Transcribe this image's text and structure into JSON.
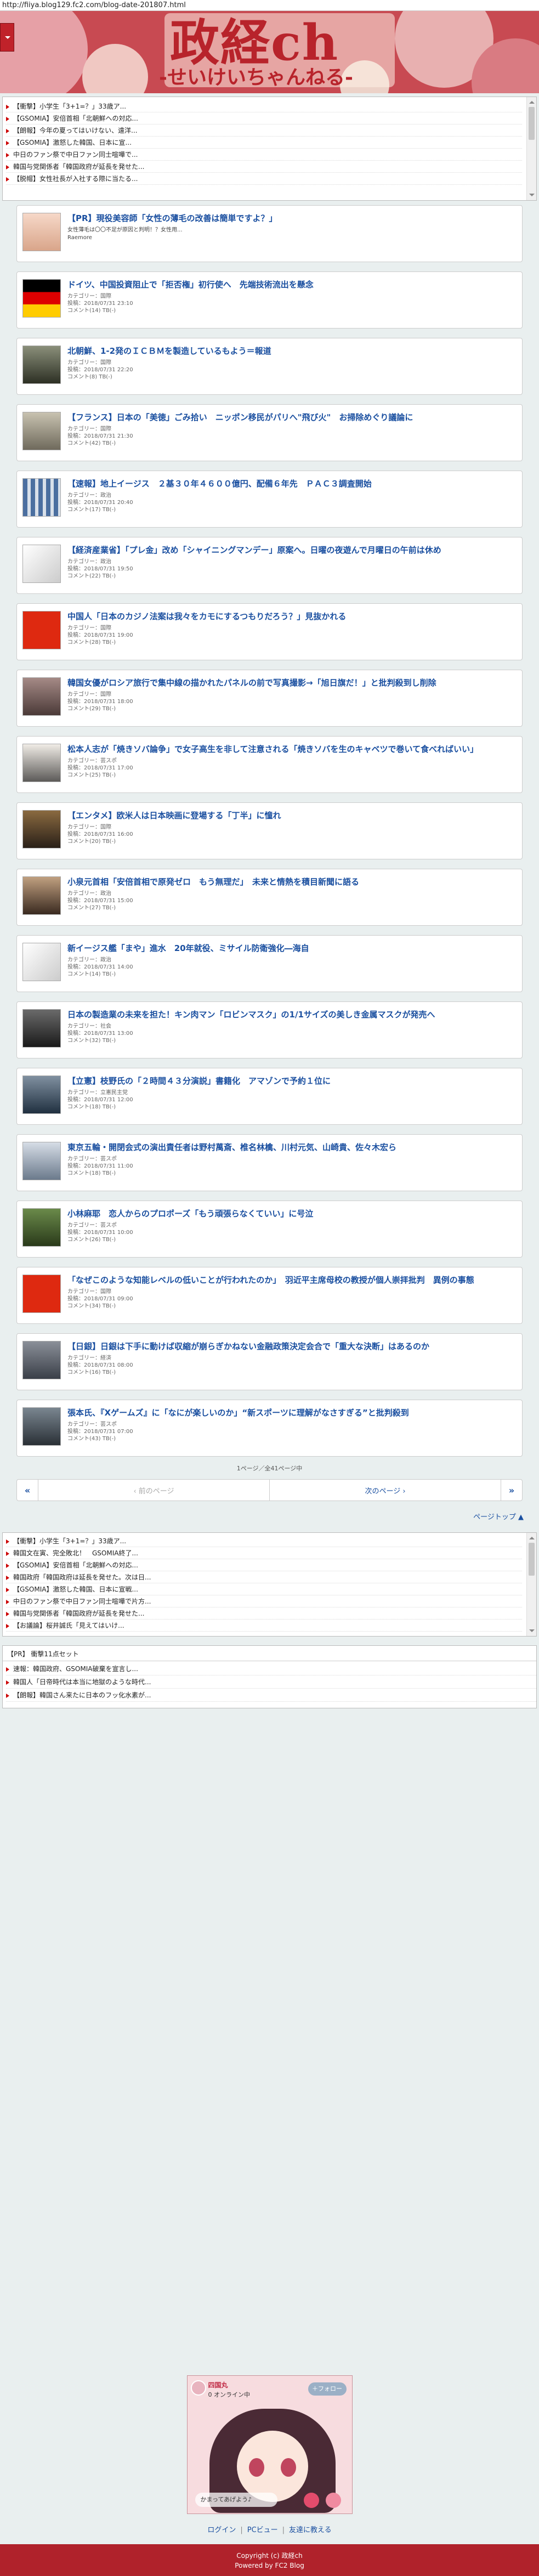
{
  "url": "http://fiiya.blog129.fc2.com/blog-date-201807.html",
  "header": {
    "title": "政経ch",
    "subtitle": "-せいけいちゃんねる-"
  },
  "ticker_top": [
    "【衝撃】小学生「3+1=？」33歳ア...",
    "【GSOMIA】安倍首相「北朝鮮への対応...",
    "【朗報】今年の夏ってはいけない、遠洋...",
    "【GSOMIA】激怒した韓国、日本に宣...",
    "中日のファン祭で中日ファン同士喧嘩で...",
    "韓国与党関係者「韓国政府が延長を発せた...",
    "【脱帽】女性社長が入社する際に当たる..."
  ],
  "articles": [
    {
      "pr": true,
      "title": "【PR】現役美容師「女性の薄毛の改善は簡単ですよ？」",
      "desc": "女性薄毛は〇〇不足が原因と判明！？女性用...",
      "source": "Raemore"
    },
    {
      "title": "ドイツ、中国投資阻止で「拒否権」初行使へ　先端技術流出を懸念",
      "category": "カテゴリー：国際",
      "posted": "投稿：2018/07/31 23:10",
      "comment": "コメント(14)  TB(-)"
    },
    {
      "title": "北朝鮮、1-2発のＩＣＢＭを製造しているもよう＝報道",
      "category": "カテゴリー：国際",
      "posted": "投稿：2018/07/31 22:20",
      "comment": "コメント(8)  TB(-)"
    },
    {
      "title": "【フランス】日本の「美徳」ごみ拾い　ニッポン移民がパリへ\"飛び火\"　お掃除めぐり議論に",
      "category": "カテゴリー：国際",
      "posted": "投稿：2018/07/31 21:30",
      "comment": "コメント(42)  TB(-)"
    },
    {
      "title": "【速報】地上イージス　２基３０年４６００億円、配備６年先　ＰＡＣ３調査開始",
      "category": "カテゴリー：政治",
      "posted": "投稿：2018/07/31 20:40",
      "comment": "コメント(17)  TB(-)"
    },
    {
      "title": "【経済産業省】「プレ金」改め「シャイニングマンデー」原案へ。日曜の夜遊んで月曜日の午前は休め",
      "category": "カテゴリー：政治",
      "posted": "投稿：2018/07/31 19:50",
      "comment": "コメント(22)  TB(-)"
    },
    {
      "title": "中国人「日本のカジノ法案は我々をカモにするつもりだろう？」見抜かれる",
      "category": "カテゴリー：国際",
      "posted": "投稿：2018/07/31 19:00",
      "comment": "コメント(28)  TB(-)"
    },
    {
      "title": "韓国女優がロシア旅行で集中線の描かれたパネルの前で写真撮影→「旭日旗だ！」と批判殺到し削除",
      "category": "カテゴリー：国際",
      "posted": "投稿：2018/07/31 18:00",
      "comment": "コメント(29)  TB(-)"
    },
    {
      "title": "松本人志が「焼きソバ論争」で女子高生を非して注意される「焼きソバを生のキャベツで巻いて食べればいい」",
      "category": "カテゴリー：芸スポ",
      "posted": "投稿：2018/07/31 17:00",
      "comment": "コメント(25)  TB(-)"
    },
    {
      "title": "【エンタメ】欧米人は日本映画に登場する「丁半」に憧れ",
      "category": "カテゴリー：国際",
      "posted": "投稿：2018/07/31 16:00",
      "comment": "コメント(20)  TB(-)"
    },
    {
      "title": "小泉元首相「安倍首相で原発ゼロ　もう無理だ」　未来と情熱を積目新聞に語る",
      "category": "カテゴリー：政治",
      "posted": "投稿：2018/07/31 15:00",
      "comment": "コメント(27)  TB(-)"
    },
    {
      "title": "新イージス艦「まや」進水　20年就役、ミサイル防衛強化―海自",
      "category": "カテゴリー：政治",
      "posted": "投稿：2018/07/31 14:00",
      "comment": "コメント(14)  TB(-)"
    },
    {
      "title": "日本の製造業の未来を担た！キン肉マン「ロビンマスク」の1/1サイズの美しき金属マスクが発売へ",
      "category": "カテゴリー：社会",
      "posted": "投稿：2018/07/31 13:00",
      "comment": "コメント(32)  TB(-)"
    },
    {
      "title": "【立憲】枝野氏の「２時間４３分演説」書籍化　アマゾンで予約１位に",
      "category": "カテゴリー：立憲民主党",
      "posted": "投稿：2018/07/31 12:00",
      "comment": "コメント(18)  TB(-)"
    },
    {
      "title": "東京五輪・開閉会式の演出責任者は野村萬斎、椎名林檎、川村元気、山崎貴、佐々木宏ら",
      "category": "カテゴリー：芸スポ",
      "posted": "投稿：2018/07/31 11:00",
      "comment": "コメント(18)  TB(-)"
    },
    {
      "title": "小林麻耶　恋人からのプロポーズ「もう頑張らなくていい」に号泣",
      "category": "カテゴリー：芸スポ",
      "posted": "投稿：2018/07/31 10:00",
      "comment": "コメント(26)  TB(-)"
    },
    {
      "title": "「なぜこのような知能レベルの低いことが行われたのか」　羽近平主席母校の教授が個人崇拝批判　異例の事態",
      "category": "カテゴリー：国際",
      "posted": "投稿：2018/07/31 09:00",
      "comment": "コメント(34)  TB(-)"
    },
    {
      "title": "【日銀】日銀は下手に動けば収縮が崩らぎかねない金融政策決定会合で「重大な決断」はあるのか",
      "category": "カテゴリー：経済",
      "posted": "投稿：2018/07/31 08:00",
      "comment": "コメント(16)  TB(-)"
    },
    {
      "title": "張本氏、『Xゲームズ』に「なにが楽しいのか」“新スポーツに理解がなさすぎる”と批判殺到",
      "category": "カテゴリー：芸スポ",
      "posted": "投稿：2018/07/31 07:00",
      "comment": "コメント(43)  TB(-)"
    }
  ],
  "pager": {
    "info": "1ページ／全41ページ中",
    "first": "«",
    "prev": "‹ 前のページ",
    "next": "次のページ ›",
    "last": "»"
  },
  "pagetop": "ページトップ ▲",
  "ticker_bottom": [
    "【衝撃】小学生「3+1=？」33歳ア...",
    "韓国文在寅、完全敗北！　GSOMIA終了...",
    "【GSOMIA】安倍首相「北朝鮮への対応...",
    "韓国政府「韓国政府は延長を発せた。次は日...",
    "【GSOMIA】激怒した韓国、日本に宣戦...",
    "中日のファン祭で中日ファン同士喧嘩で片方...",
    "韓国与党関係者「韓国政府が延長を発せた...",
    "【お議論】桜井誠氏「見えてはいけ..."
  ],
  "pr_box": {
    "header": "【PR】 衝撃11点セット",
    "items": [
      "速報：韓国政府、GSOMIA破棄を宣言し...",
      "韓国人「日帝時代は本当に地獄のような時代...",
      "【朗報】韓国さん来たに日本のフッ化水素が..."
    ]
  },
  "widget": {
    "name": "四国丸",
    "online": "0 オンライン中",
    "follow": "＋フォロー",
    "msg": "かまってあげよう♪"
  },
  "footer": {
    "login": "ログイン",
    "pc": "PCビュー",
    "share": "友達に教える",
    "sep": "|"
  },
  "copyright": "Copyright (c) 政経ch",
  "powered": "Powered by FC2 Blog"
}
